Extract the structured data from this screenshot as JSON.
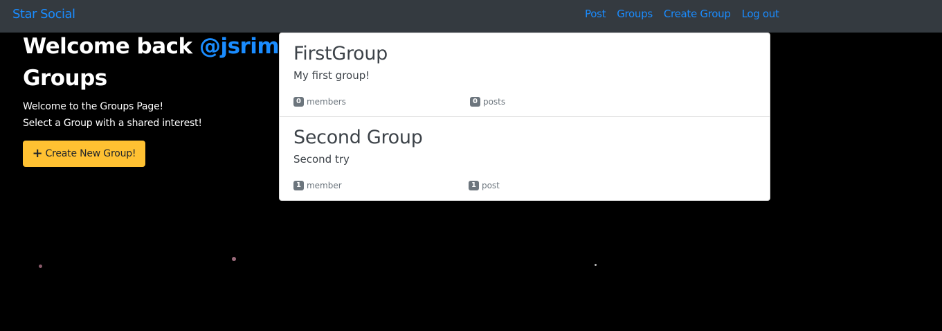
{
  "navbar": {
    "brand": "Star Social",
    "links": [
      "Post",
      "Groups",
      "Create Group",
      "Log out"
    ]
  },
  "welcome": {
    "prefix": "Welcome back ",
    "username": "@jsrimr"
  },
  "page": {
    "heading": "Groups",
    "intro_line1": "Welcome to the Groups Page!",
    "intro_line2": "Select a Group with a shared interest!",
    "create_button": "Create New Group!"
  },
  "groups": [
    {
      "name": "FirstGroup",
      "description": "My first group!",
      "member_count": "0",
      "member_label": "members",
      "post_count": "0",
      "post_label": "posts"
    },
    {
      "name": "Second Group",
      "description": "Second try",
      "member_count": "1",
      "member_label": "member",
      "post_count": "1",
      "post_label": "post"
    }
  ],
  "colors": {
    "navbar_bg": "#343a40",
    "link": "#1a8cff",
    "page_bg": "#000000",
    "button_bg": "#ffc132",
    "badge_bg": "#6c757d"
  }
}
